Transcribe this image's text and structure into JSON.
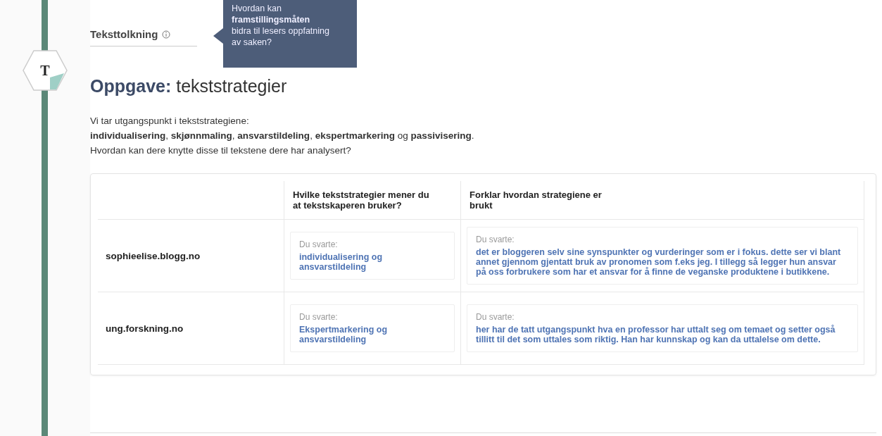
{
  "badge": "T",
  "section": {
    "title": "Teksttolkning",
    "tooltip": "Hvordan kan **framstillingsmåten** bidra til lesers oppfatning av saken?"
  },
  "task": {
    "label": "Oppgave:",
    "title": "tekststrategier"
  },
  "intro": [
    "Vi tar utgangspunkt i tekststrategiene:",
    "**individualisering**, **skjønnmaling**, **ansvarstildeling**, **ekspertmarkering** og **passivisering**.",
    "Hvordan kan dere knytte disse til tekstene dere har analysert?"
  ],
  "table": {
    "columns": [
      "Hvilke tekststrategier mener du at tekstskaperen bruker?",
      "Forklar hvordan strategiene er brukt"
    ],
    "rows": [
      {
        "source": "sophieelise.blogg.no",
        "answers": [
          {
            "label": "Du svarte:",
            "text": "individualisering og ansvarstildeling"
          },
          {
            "label": "Du svarte:",
            "text": "det er bloggeren selv sine synspunkter og vurderinger som er i fokus. dette ser vi blant annet gjennom gjentatt bruk av pronomen som f.eks jeg. I tillegg så legger hun ansvar på oss forbrukere som har et ansvar for å finne de veganske produktene i butikkene."
          }
        ]
      },
      {
        "source": "ung.forskning.no",
        "answers": [
          {
            "label": "Du svarte:",
            "text": "Ekspertmarkering og ansvarstildeling"
          },
          {
            "label": "Du svarte:",
            "text": "her har de tatt utgangspunkt hva en professor har uttalt seg om temaet og setter også tillitt til det som uttales som riktig. Han har kunnskap og kan da uttalelse om dette."
          }
        ]
      }
    ]
  }
}
